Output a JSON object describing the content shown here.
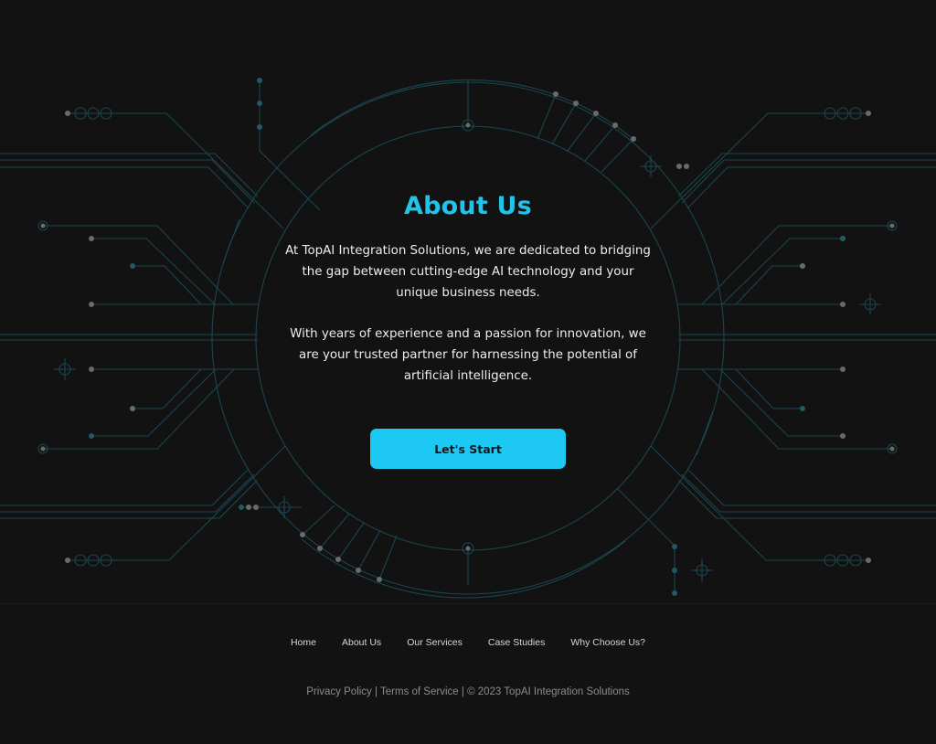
{
  "hero": {
    "title": "About Us",
    "paragraph_1": "At TopAI Integration Solutions, we are dedicated to bridging the gap between cutting-edge AI technology and your unique business needs.",
    "paragraph_2": "With years of experience and a passion for innovation, we are your trusted partner for harnessing the potential of artificial intelligence.",
    "cta_label": "Let's Start"
  },
  "footer": {
    "nav": [
      {
        "label": "Home"
      },
      {
        "label": "About Us"
      },
      {
        "label": "Our Services"
      },
      {
        "label": "Case Studies"
      },
      {
        "label": "Why Choose Us?"
      }
    ],
    "privacy_label": "Privacy Policy",
    "terms_label": "Terms of Service",
    "separator": "|",
    "copyright": "© 2023 TopAI Integration Solutions"
  },
  "colors": {
    "background": "#121212",
    "accent": "#22c3ea",
    "button": "#1dc8f2",
    "circuit_line": "#1d4a52",
    "circuit_node": "#6b6b6b"
  }
}
